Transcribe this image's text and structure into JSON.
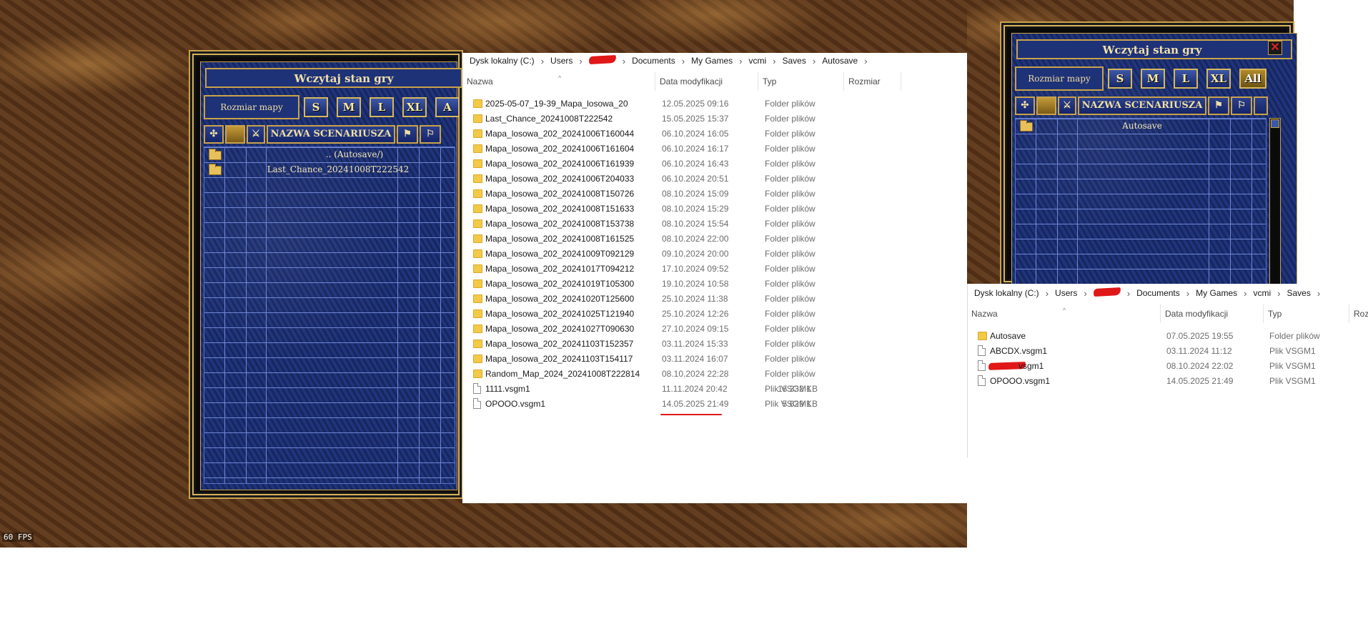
{
  "fps_label": "60 FPS",
  "game_left": {
    "title": "Wczytaj stan gry",
    "map_size_label": "Rozmiar mapy",
    "size_buttons": [
      "S",
      "M",
      "L",
      "XL",
      "A"
    ],
    "scenario_header": "NAZWA SCENARIUSZA",
    "rows": [
      {
        "name": "..    (Autosave/)"
      },
      {
        "name": "Last_Chance_20241008T222542"
      }
    ]
  },
  "game_right": {
    "title": "Wczytaj stan gry",
    "map_size_label": "Rozmiar mapy",
    "size_buttons": [
      "S",
      "M",
      "L",
      "XL",
      "All"
    ],
    "scenario_header": "NAZWA SCENARIUSZA",
    "rows": [
      {
        "name": "Autosave"
      }
    ]
  },
  "explorer_main": {
    "breadcrumbs": [
      "Dysk lokalny (C:)",
      "Users",
      "",
      "Documents",
      "My Games",
      "vcmi",
      "Saves",
      "Autosave"
    ],
    "headers": {
      "name": "Nazwa",
      "date": "Data modyfikacji",
      "type": "Typ",
      "size": "Rozmiar"
    },
    "rows": [
      {
        "name": "2025-05-07_19-39_Mapa_losowa_20",
        "date": "12.05.2025 09:16",
        "type": "Folder plików",
        "size": "",
        "kind": "folder"
      },
      {
        "name": "Last_Chance_20241008T222542",
        "date": "15.05.2025 15:37",
        "type": "Folder plików",
        "size": "",
        "kind": "folder"
      },
      {
        "name": "Mapa_losowa_202_20241006T160044",
        "date": "06.10.2024 16:05",
        "type": "Folder plików",
        "size": "",
        "kind": "folder"
      },
      {
        "name": "Mapa_losowa_202_20241006T161604",
        "date": "06.10.2024 16:17",
        "type": "Folder plików",
        "size": "",
        "kind": "folder"
      },
      {
        "name": "Mapa_losowa_202_20241006T161939",
        "date": "06.10.2024 16:43",
        "type": "Folder plików",
        "size": "",
        "kind": "folder"
      },
      {
        "name": "Mapa_losowa_202_20241006T204033",
        "date": "06.10.2024 20:51",
        "type": "Folder plików",
        "size": "",
        "kind": "folder"
      },
      {
        "name": "Mapa_losowa_202_20241008T150726",
        "date": "08.10.2024 15:09",
        "type": "Folder plików",
        "size": "",
        "kind": "folder"
      },
      {
        "name": "Mapa_losowa_202_20241008T151633",
        "date": "08.10.2024 15:29",
        "type": "Folder plików",
        "size": "",
        "kind": "folder"
      },
      {
        "name": "Mapa_losowa_202_20241008T153738",
        "date": "08.10.2024 15:54",
        "type": "Folder plików",
        "size": "",
        "kind": "folder"
      },
      {
        "name": "Mapa_losowa_202_20241008T161525",
        "date": "08.10.2024 22:00",
        "type": "Folder plików",
        "size": "",
        "kind": "folder"
      },
      {
        "name": "Mapa_losowa_202_20241009T092129",
        "date": "09.10.2024 20:00",
        "type": "Folder plików",
        "size": "",
        "kind": "folder"
      },
      {
        "name": "Mapa_losowa_202_20241017T094212",
        "date": "17.10.2024 09:52",
        "type": "Folder plików",
        "size": "",
        "kind": "folder"
      },
      {
        "name": "Mapa_losowa_202_20241019T105300",
        "date": "19.10.2024 10:58",
        "type": "Folder plików",
        "size": "",
        "kind": "folder"
      },
      {
        "name": "Mapa_losowa_202_20241020T125600",
        "date": "25.10.2024 11:38",
        "type": "Folder plików",
        "size": "",
        "kind": "folder"
      },
      {
        "name": "Mapa_losowa_202_20241025T121940",
        "date": "25.10.2024 12:26",
        "type": "Folder plików",
        "size": "",
        "kind": "folder"
      },
      {
        "name": "Mapa_losowa_202_20241027T090630",
        "date": "27.10.2024 09:15",
        "type": "Folder plików",
        "size": "",
        "kind": "folder"
      },
      {
        "name": "Mapa_losowa_202_20241103T152357",
        "date": "03.11.2024 15:33",
        "type": "Folder plików",
        "size": "",
        "kind": "folder"
      },
      {
        "name": "Mapa_losowa_202_20241103T154117",
        "date": "03.11.2024 16:07",
        "type": "Folder plików",
        "size": "",
        "kind": "folder"
      },
      {
        "name": "Random_Map_2024_20241008T222814",
        "date": "08.10.2024 22:28",
        "type": "Folder plików",
        "size": "",
        "kind": "folder"
      },
      {
        "name": "1111.vsgm1",
        "date": "11.11.2024 20:42",
        "type": "Plik VSGM1",
        "size": "16 332 KB",
        "kind": "file"
      },
      {
        "name": "OPOOO.vsgm1",
        "date": "14.05.2025 21:49",
        "type": "Plik VSGM1",
        "size": "5 629 KB",
        "kind": "file"
      }
    ]
  },
  "explorer_second": {
    "breadcrumbs": [
      "Dysk lokalny (C:)",
      "Users",
      "",
      "Documents",
      "My Games",
      "vcmi",
      "Saves"
    ],
    "headers": {
      "name": "Nazwa",
      "date": "Data modyfikacji",
      "type": "Typ",
      "size": "Roz"
    },
    "rows": [
      {
        "name": "Autosave",
        "date": "07.05.2025 19:55",
        "type": "Folder plików",
        "kind": "folder"
      },
      {
        "name": "ABCDX.vsgm1",
        "date": "03.11.2024 11:12",
        "type": "Plik VSGM1",
        "kind": "file"
      },
      {
        "name": "vsgm1",
        "date": "08.10.2024 22:02",
        "type": "Plik VSGM1",
        "kind": "file"
      },
      {
        "name": "OPOOO.vsgm1",
        "date": "14.05.2025 21:49",
        "type": "Plik VSGM1",
        "kind": "file"
      }
    ]
  }
}
